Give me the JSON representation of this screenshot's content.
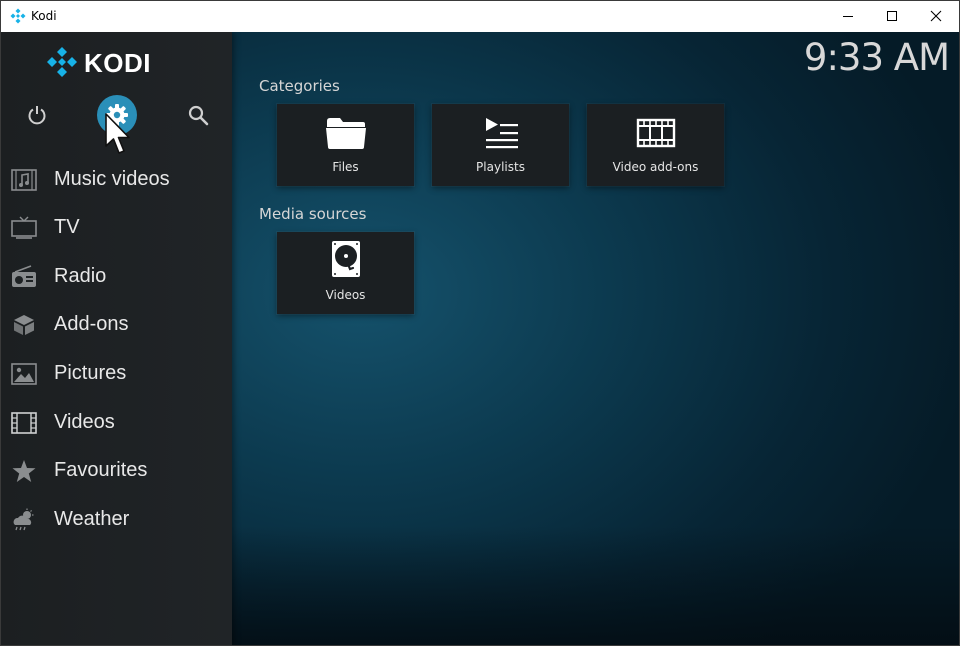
{
  "window": {
    "title": "Kodi"
  },
  "sidebar": {
    "logo_text": "KODI",
    "top_buttons": {
      "power": "power-icon",
      "settings": "gear-icon",
      "search": "search-icon"
    },
    "items": [
      {
        "label": "Music videos",
        "icon": "music-video-icon"
      },
      {
        "label": "TV",
        "icon": "tv-icon"
      },
      {
        "label": "Radio",
        "icon": "radio-icon"
      },
      {
        "label": "Add-ons",
        "icon": "addons-box-icon"
      },
      {
        "label": "Pictures",
        "icon": "picture-icon"
      },
      {
        "label": "Videos",
        "icon": "film-icon"
      },
      {
        "label": "Favourites",
        "icon": "star-icon"
      },
      {
        "label": "Weather",
        "icon": "weather-icon"
      }
    ]
  },
  "clock": "9:33 AM",
  "main": {
    "categories_title": "Categories",
    "categories": [
      {
        "label": "Files",
        "icon": "folder-icon"
      },
      {
        "label": "Playlists",
        "icon": "playlist-icon"
      },
      {
        "label": "Video add-ons",
        "icon": "film-strip-icon"
      }
    ],
    "media_sources_title": "Media sources",
    "media_sources": [
      {
        "label": "Videos",
        "icon": "hard-drive-icon"
      }
    ]
  },
  "colors": {
    "accent": "#2a8fb8",
    "kodi_blue": "#17b2e7",
    "sidebar_bg": "#1e2224",
    "tile_bg": "#1b1f22"
  }
}
